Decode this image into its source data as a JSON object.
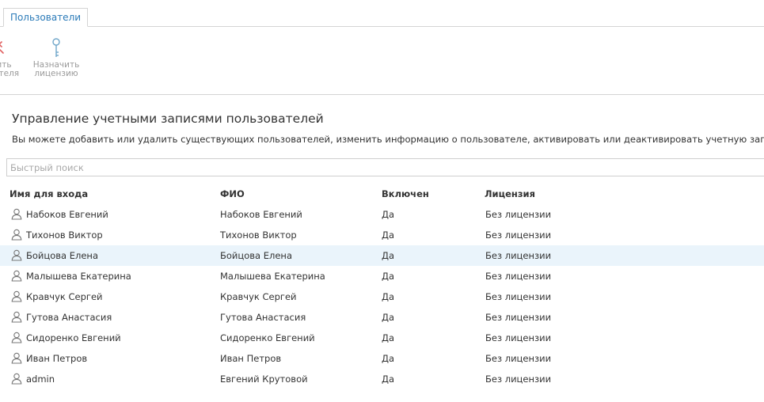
{
  "tabs": [
    {
      "label": "Пользователи"
    }
  ],
  "toolbar": {
    "cut_button": {
      "line1": "ить",
      "line2": "вателя",
      "icon": "red-cross-icon"
    },
    "assign_license": {
      "line1": "Назначить",
      "line2": "лицензию",
      "icon": "key-icon"
    }
  },
  "page": {
    "title": "Управление учетными записями пользователей",
    "description": "Вы можете добавить или удалить существующих пользователей, изменить информацию о пользователе, активировать или деактивировать учетную запись."
  },
  "search": {
    "placeholder": "Быстрый поиск",
    "value": ""
  },
  "table": {
    "columns": [
      "Имя для входа",
      "ФИО",
      "Включен",
      "Лицензия"
    ],
    "rows": [
      {
        "login": "Набоков Евгений",
        "fio": "Набоков Евгений",
        "enabled": "Да",
        "license": "Без лицензии"
      },
      {
        "login": "Тихонов Виктор",
        "fio": "Тихонов Виктор",
        "enabled": "Да",
        "license": "Без лицензии"
      },
      {
        "login": "Бойцова Елена",
        "fio": "Бойцова Елена",
        "enabled": "Да",
        "license": "Без лицензии"
      },
      {
        "login": "Малышева Екатерина",
        "fio": "Малышева Екатерина",
        "enabled": "Да",
        "license": "Без лицензии"
      },
      {
        "login": "Кравчук Сергей",
        "fio": "Кравчук Сергей",
        "enabled": "Да",
        "license": "Без лицензии"
      },
      {
        "login": "Гутова Анастасия",
        "fio": "Гутова Анастасия",
        "enabled": "Да",
        "license": "Без лицензии"
      },
      {
        "login": "Сидоренко Евгений",
        "fio": "Сидоренко Евгений",
        "enabled": "Да",
        "license": "Без лицензии"
      },
      {
        "login": "Иван Петров",
        "fio": "Иван Петров",
        "enabled": "Да",
        "license": "Без лицензии"
      },
      {
        "login": "admin",
        "fio": "Евгений Крутовой",
        "enabled": "Да",
        "license": "Без лицензии"
      }
    ],
    "selected_row": 2,
    "row_icon": "user-icon"
  },
  "colors": {
    "accent": "#2a7ab8",
    "selected_row": "#eaf4fb",
    "border": "#d4d4d4",
    "muted": "#9a9a9a",
    "key_icon": "#6fa6c9",
    "cross_icon": "#e06060"
  }
}
